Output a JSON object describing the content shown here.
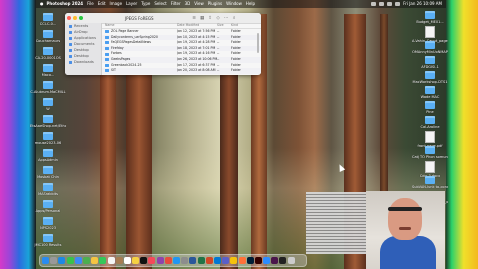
{
  "menubar": {
    "app_name": "Photoshop 2024",
    "menus": [
      "File",
      "Edit",
      "Image",
      "Layer",
      "Type",
      "Select",
      "Filter",
      "3D",
      "View",
      "Plugins",
      "Window",
      "Help"
    ],
    "clock": "Fri Jan 26 10:09 AM"
  },
  "finder": {
    "title": "JPEGS FoREGS",
    "sidebar": [
      "Recents",
      "AirDrop",
      "Applications",
      "Documents",
      "Desktop",
      "Desktop",
      "Downloads"
    ],
    "columns": [
      "Name",
      "Date Modified",
      "Size",
      "Kind"
    ],
    "rows": [
      {
        "name": "ZOL Page Banner",
        "date": "Jan 12, 2023 at 7:56 PM",
        "size": "--",
        "kind": "Folder"
      },
      {
        "name": "Dailyconterns_uzrSpring2020",
        "date": "Jan 10, 2023 at 4:15 PM",
        "size": "--",
        "kind": "Folder"
      },
      {
        "name": "FaQEGSPagesDetailNews",
        "date": "Jan 19, 2023 at 4:28 PM",
        "size": "--",
        "kind": "Folder"
      },
      {
        "name": "Firefday",
        "date": "Jan 18, 2023 at 7:01 PM",
        "size": "--",
        "kind": "Folder"
      },
      {
        "name": "Forbes",
        "date": "Jan 19, 2023 at 4:16 PM",
        "size": "--",
        "kind": "Folder"
      },
      {
        "name": "GeeksPages",
        "date": "Jan 26, 2023 at 10:06 PM",
        "size": "--",
        "kind": "Folder"
      },
      {
        "name": "Greenback2024-25",
        "date": "Jan 17, 2023 at 6:37 PM",
        "size": "--",
        "kind": "Folder"
      },
      {
        "name": "SIT",
        "date": "Jan 20, 2023 at 8:08 AM",
        "size": "--",
        "kind": "Folder"
      }
    ]
  },
  "desktop_left": [
    "CCI-C-0...",
    "Coucharnaurs",
    "CA-20-0001OS",
    "Maco...",
    "C-Alubrum.MaCMILL",
    "W",
    "EtsAaeShop.net/Etho...",
    "mouse2023-06",
    "AppsAdmin",
    "Mosbat Chin",
    "MASrabbits",
    "Apps/Personal",
    "NPS2023",
    "JMC100 Results"
  ],
  "desktop_right": [
    "Budget_ME01...",
    "A-Vahin_Caput_page1.pdf",
    "OMAnnyMinUoNMAP",
    "AFDGISI-1",
    "MacWorkshop-DTS1",
    "Wade MAC",
    "Pine",
    "Cal-Aroline",
    "front page.pdf",
    "Catj TO Phon somunewsla",
    "Cdq_3.docx",
    "SubVAN-lunk to-conduction",
    "submap Hmm-png_ore..AH ring",
    "Photoshop 1",
    "Reclamation",
    "newlinks"
  ],
  "dock": {
    "apps": [
      "finder-icon",
      "launchpad-icon",
      "safari-icon",
      "messages-icon",
      "mail-icon",
      "maps-icon",
      "photos-icon",
      "facetime-icon",
      "calendar-icon",
      "contacts-icon",
      "reminders-icon",
      "notes-icon",
      "tv-icon",
      "music-icon",
      "podcasts-icon",
      "news-icon",
      "appstore-icon",
      "settings-icon",
      "word-icon",
      "excel-icon",
      "powerpoint-icon",
      "outlook-icon",
      "teams-icon",
      "chrome-icon",
      "firefox-icon",
      "photoshop-icon",
      "illustrator-icon",
      "zoom-icon",
      "slack-icon",
      "terminal-icon",
      "trash-icon"
    ],
    "colors": [
      "#2a8cf0",
      "#999",
      "#1e88e5",
      "#39c24b",
      "#3d8af5",
      "#4caf50",
      "#f4c542",
      "#35c759",
      "#f5f5f5",
      "#a67c52",
      "#fff",
      "#f5d142",
      "#111",
      "#f54a5a",
      "#8e44ad",
      "#e74c3c",
      "#2196f3",
      "#8d8d8d",
      "#2b579a",
      "#217346",
      "#d24726",
      "#0078d4",
      "#5b5fc7",
      "#f4c20d",
      "#ff7139",
      "#001e36",
      "#330000",
      "#2d8cff",
      "#4a154b",
      "#222",
      "#ccc"
    ]
  }
}
